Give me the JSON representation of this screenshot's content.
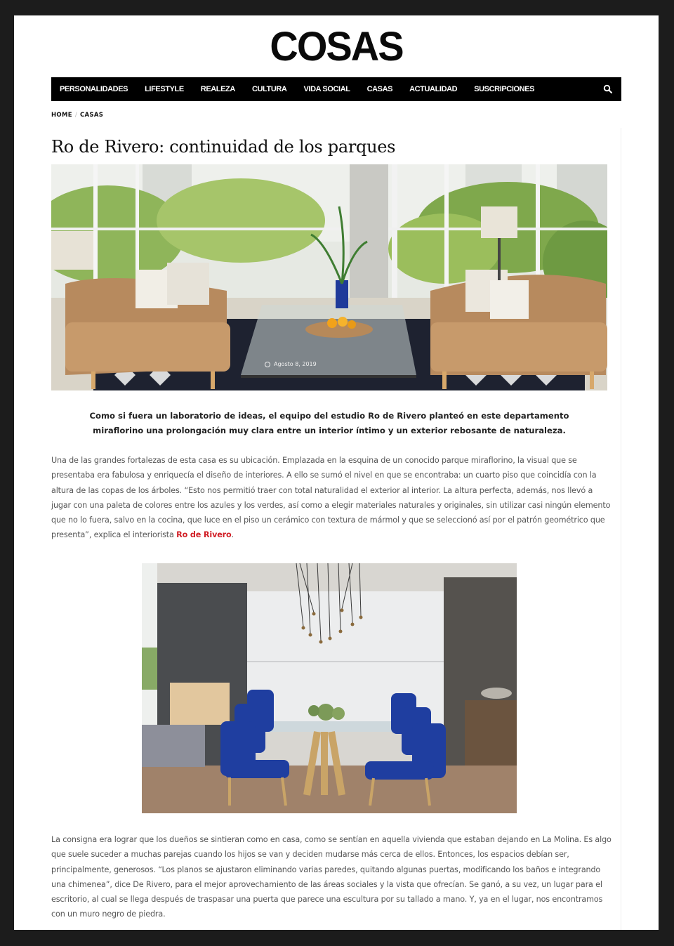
{
  "site": {
    "logo": "COSAS"
  },
  "nav": {
    "items": [
      "PERSONALIDADES",
      "LIFESTYLE",
      "REALEZA",
      "CULTURA",
      "VIDA SOCIAL",
      "CASAS",
      "ACTUALIDAD",
      "SUSCRIPCIONES"
    ],
    "search_icon": "search-icon"
  },
  "breadcrumb": {
    "home": "HOME",
    "separator": "/",
    "current": "CASAS"
  },
  "article": {
    "title": "Ro de Rivero: continuidad de los parques",
    "date": "Agosto 8, 2019",
    "lead": "Como si fuera un laboratorio de ideas, el equipo del estudio Ro de Rivero planteó en este departamento miraflorino una prolongación muy clara entre un interior íntimo y un exterior rebosante de naturaleza.",
    "p1_text": "Una de las grandes fortalezas de esta casa es su ubicación. Emplazada en la esquina de un conocido parque miraflorino, la visual que se presentaba era fabulosa y enriquecía el diseño de interiores. A ello se sumó el nivel en que se encontraba: un cuarto piso que coincidía con la altura de las copas de los árboles. “Esto nos permitió traer con total naturalidad el exterior al interior. La altura perfecta, además, nos llevó a jugar con una paleta de colores entre los azules y los verdes, así como a elegir materiales naturales y originales, sin utilizar casi ningún elemento que no lo fuera, salvo en la cocina, que luce en el piso un cerámico con textura de mármol y que se seleccionó así por el patrón geométrico que presenta”, explica el interiorista ",
    "p1_link": "Ro de Rivero",
    "p1_end": ".",
    "p2_text": "La consigna era lograr que los dueños se sintieran como en casa, como se sentían en aquella vivienda que estaban dejando en La Molina. Es algo que suele suceder a muchas parejas cuando los hijos se van y deciden mudarse más cerca de ellos. Entonces, los espacios debían ser, principalmente, generosos. “Los planos se ajustaron eliminando varias paredes, quitando algunas puertas, modificando los baños e integrando una chimenea”, dice De Rivero, para el mejor aprovechamiento de las áreas sociales y la vista que ofrecían. Se ganó, a su vez, un lugar para el escritorio, al cual se llega después de traspasar una puerta que parece una escultura por su tallado a mano. Y, ya en el lugar, nos encontramos con un muro negro de piedra."
  },
  "colors": {
    "accent": "#d11f26",
    "nav_bg": "#000000",
    "frame": "#1c1c1c"
  }
}
